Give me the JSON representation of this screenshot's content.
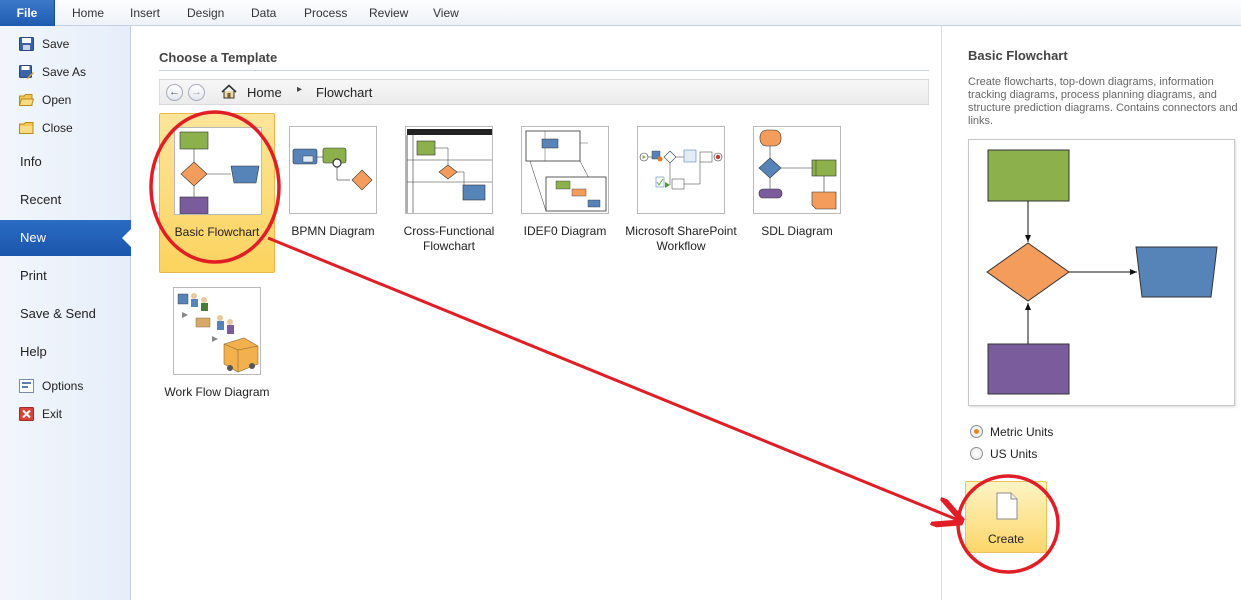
{
  "ribbon": {
    "tabs": [
      "File",
      "Home",
      "Insert",
      "Design",
      "Data",
      "Process",
      "Review",
      "View"
    ],
    "active_tab": "File"
  },
  "backstage": {
    "commands": [
      {
        "label": "Save",
        "icon": "save-icon"
      },
      {
        "label": "Save As",
        "icon": "save-as-icon"
      },
      {
        "label": "Open",
        "icon": "open-folder-icon"
      },
      {
        "label": "Close",
        "icon": "close-folder-icon"
      }
    ],
    "sections": [
      "Info",
      "Recent",
      "New",
      "Print",
      "Save & Send",
      "Help"
    ],
    "selected_section": "New",
    "footer_commands": [
      {
        "label": "Options",
        "icon": "options-icon"
      },
      {
        "label": "Exit",
        "icon": "exit-icon"
      }
    ]
  },
  "templates": {
    "heading": "Choose a Template",
    "breadcrumb": [
      "Home",
      "Flowchart"
    ],
    "items": [
      {
        "label": "Basic Flowchart",
        "selected": true
      },
      {
        "label": "BPMN Diagram"
      },
      {
        "label": "Cross-Functional Flowchart"
      },
      {
        "label": "IDEF0 Diagram"
      },
      {
        "label": "Microsoft SharePoint Workflow"
      },
      {
        "label": "SDL Diagram"
      },
      {
        "label": "Work Flow Diagram"
      }
    ]
  },
  "details": {
    "title": "Basic Flowchart",
    "description": "Create flowcharts, top-down diagrams, information tracking diagrams, process planning diagrams, and structure prediction diagrams. Contains connectors and links.",
    "units": [
      {
        "label": "Metric Units",
        "checked": true
      },
      {
        "label": "US Units",
        "checked": false
      }
    ],
    "create_label": "Create"
  },
  "colors": {
    "accent": "#1e5bb0",
    "selection": "#fbd35e",
    "annotation": "#e11d25",
    "shape_green": "#8cb04c",
    "shape_orange": "#f49c5c",
    "shape_blue": "#5683b8",
    "shape_purple": "#7a5c9c"
  }
}
